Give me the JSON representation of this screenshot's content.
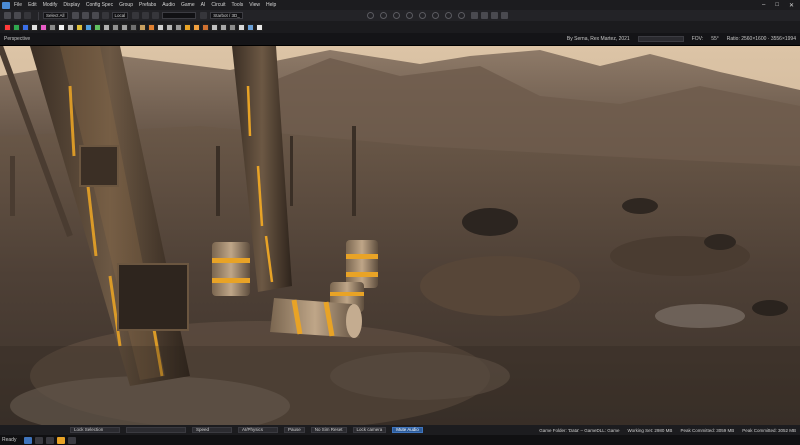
{
  "menubar": {
    "items": [
      "File",
      "Edit",
      "Modify",
      "Display",
      "Config Spec",
      "Group",
      "Prefabs",
      "Audio",
      "Game",
      "AI",
      "Circuit",
      "Tools",
      "View",
      "Help"
    ]
  },
  "toolbar": {
    "selection_mode": "Select All",
    "coord_system": "Local",
    "level_name": "Starbot / 3D_"
  },
  "viewport": {
    "label": "Perspective",
    "author": "By Serna, Rex Martez, 2021",
    "fov_label": "FOV:",
    "fov_value": "55°",
    "ratio": "Ratio: 2560×1600 · 3556×1994"
  },
  "timeline": {
    "field1": "Lock Selection",
    "field2": "Speed",
    "field3": "AI/Physics",
    "btn_pause": "Pause",
    "btn_nophys": "No Sim Reset",
    "btn_lock": "Lock camera",
    "btn_mute": "Mute Audio",
    "stats": [
      "Game Folder: 'Data' – GameDLL: Game",
      "Working Set: 2980 MB",
      "Peak Committed: 3059 MB",
      "Peak Committed: 3052 MB"
    ]
  },
  "status": {
    "text": "Ready"
  },
  "colors": {
    "sky_top": "#d9c2a8",
    "sky_bottom": "#b99f86",
    "ground": "#5b4a3c",
    "accent_blue": "#3f74bd",
    "hazard_yellow": "#e8a326"
  }
}
